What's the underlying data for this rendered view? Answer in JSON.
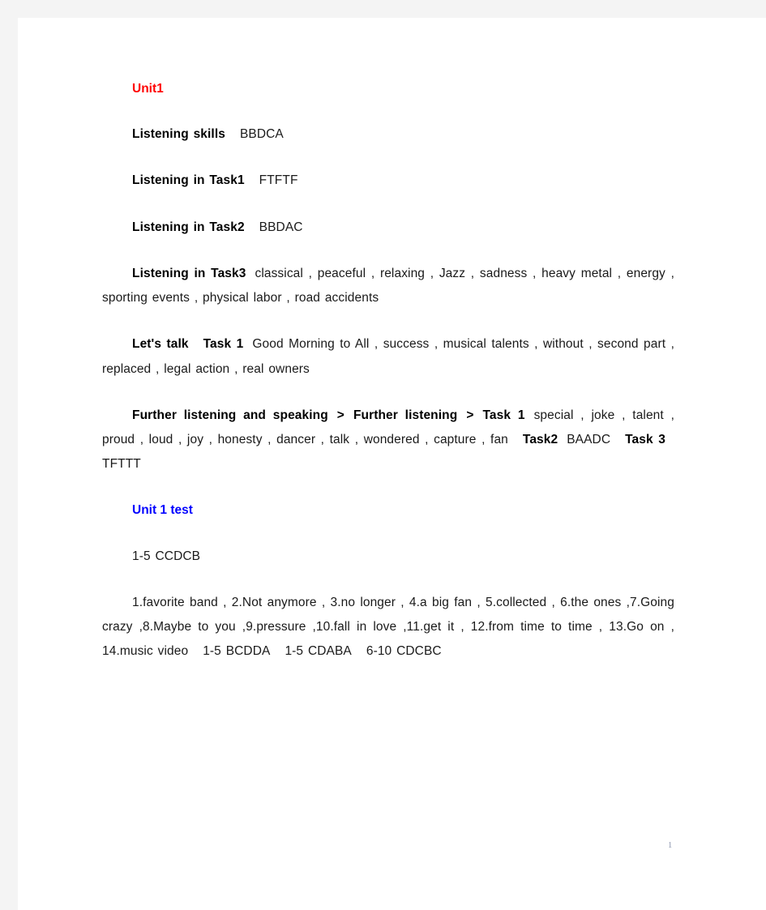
{
  "document": {
    "page_number": "1",
    "colors": {
      "unit_heading": "#ff0000",
      "test_heading": "#0000ff",
      "body_text": "#1a1a1a",
      "page_background": "#ffffff",
      "canvas_background": "#f4f4f4",
      "page_number": "#8a94ad"
    }
  },
  "blocks": {
    "unit_heading": "Unit1",
    "listening_skills": {
      "label": "Listening skills",
      "answers": "BBDCA"
    },
    "listening_in_task1": {
      "label": "Listening in Task1",
      "answers": "FTFTF"
    },
    "listening_in_task2": {
      "label": "Listening in Task2",
      "answers": "BBDAC"
    },
    "listening_in_task3": {
      "label": "Listening in Task3",
      "answers": "classical , peaceful , relaxing , Jazz , sadness , heavy metal , energy , sporting events , physical labor , road accidents"
    },
    "lets_talk": {
      "label": "Let's talk",
      "task_label": "Task 1",
      "answers": "Good Morning to All , success , musical talents , without , second part , replaced , legal action , real owners"
    },
    "further_listening": {
      "breadcrumb_part1": "Further listening and speaking",
      "breadcrumb_separator": ">",
      "breadcrumb_part2": "Further listening",
      "task1_label": "Task 1",
      "task1_answers": "special , joke , talent , proud , loud , joy , honesty , dancer , talk , wondered , capture , fan",
      "task2_label": "Task2",
      "task2_answers": "BAADC",
      "task3_label": "Task 3",
      "task3_answers": "TFTTT"
    },
    "unit_test_heading": "Unit 1 test",
    "test_answers_1_5": "1-5 CCDCB",
    "test_fill_ins": "1.favorite band  , 2.Not anymore  , 3.no longer  , 4.a big fan  , 5.collected  , 6.the ones  ,7.Going crazy  ,8.Maybe to you  ,9.pressure  ,10.fall in love  ,11.get it  , 12.from time to time  , 13.Go on  , 14.music video",
    "test_answers_extra_1": "1-5 BCDDA",
    "test_answers_extra_2": "1-5 CDABA",
    "test_answers_extra_3": "6-10 CDCBC"
  }
}
